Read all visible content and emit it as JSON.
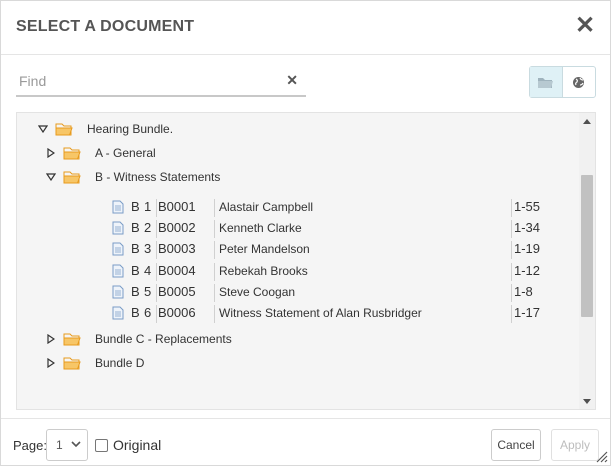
{
  "dialog": {
    "title": "SELECT A DOCUMENT",
    "close_icon": "close-icon"
  },
  "search": {
    "placeholder": "Find",
    "value": "",
    "clear_icon": "clear-icon"
  },
  "view_toggle": {
    "folder_icon": "folder-view-icon",
    "globe_icon": "globe-view-icon",
    "active": "folder"
  },
  "tree": {
    "root": {
      "label": "Hearing Bundle.",
      "expanded": true
    },
    "bundles": [
      {
        "label": "A - General",
        "expanded": false
      },
      {
        "label": "B - Witness Statements",
        "expanded": true
      },
      {
        "label": "Bundle C - Replacements",
        "expanded": false
      },
      {
        "label": "Bundle D",
        "expanded": false
      }
    ],
    "documents": [
      {
        "bundle": "B",
        "num": "1",
        "code": "B0001",
        "title": "Alastair Campbell",
        "pages": "1-55"
      },
      {
        "bundle": "B",
        "num": "2",
        "code": "B0002",
        "title": "Kenneth Clarke",
        "pages": "1-34"
      },
      {
        "bundle": "B",
        "num": "3",
        "code": "B0003",
        "title": "Peter Mandelson",
        "pages": "1-19"
      },
      {
        "bundle": "B",
        "num": "4",
        "code": "B0004",
        "title": "Rebekah Brooks",
        "pages": "1-12"
      },
      {
        "bundle": "B",
        "num": "5",
        "code": "B0005",
        "title": "Steve Coogan",
        "pages": "1-8"
      },
      {
        "bundle": "B",
        "num": "6",
        "code": "B0006",
        "title": "Witness Statement of Alan Rusbridger",
        "pages": "1-17"
      }
    ]
  },
  "footer": {
    "page_label": "Page:",
    "page_value": "1",
    "original_label": "Original",
    "original_checked": false,
    "cancel_label": "Cancel",
    "apply_label": "Apply",
    "apply_enabled": false
  },
  "colors": {
    "folder": "#f0a830",
    "doc_icon": "#7a9cc6",
    "active_toggle": "#dff1f6"
  }
}
